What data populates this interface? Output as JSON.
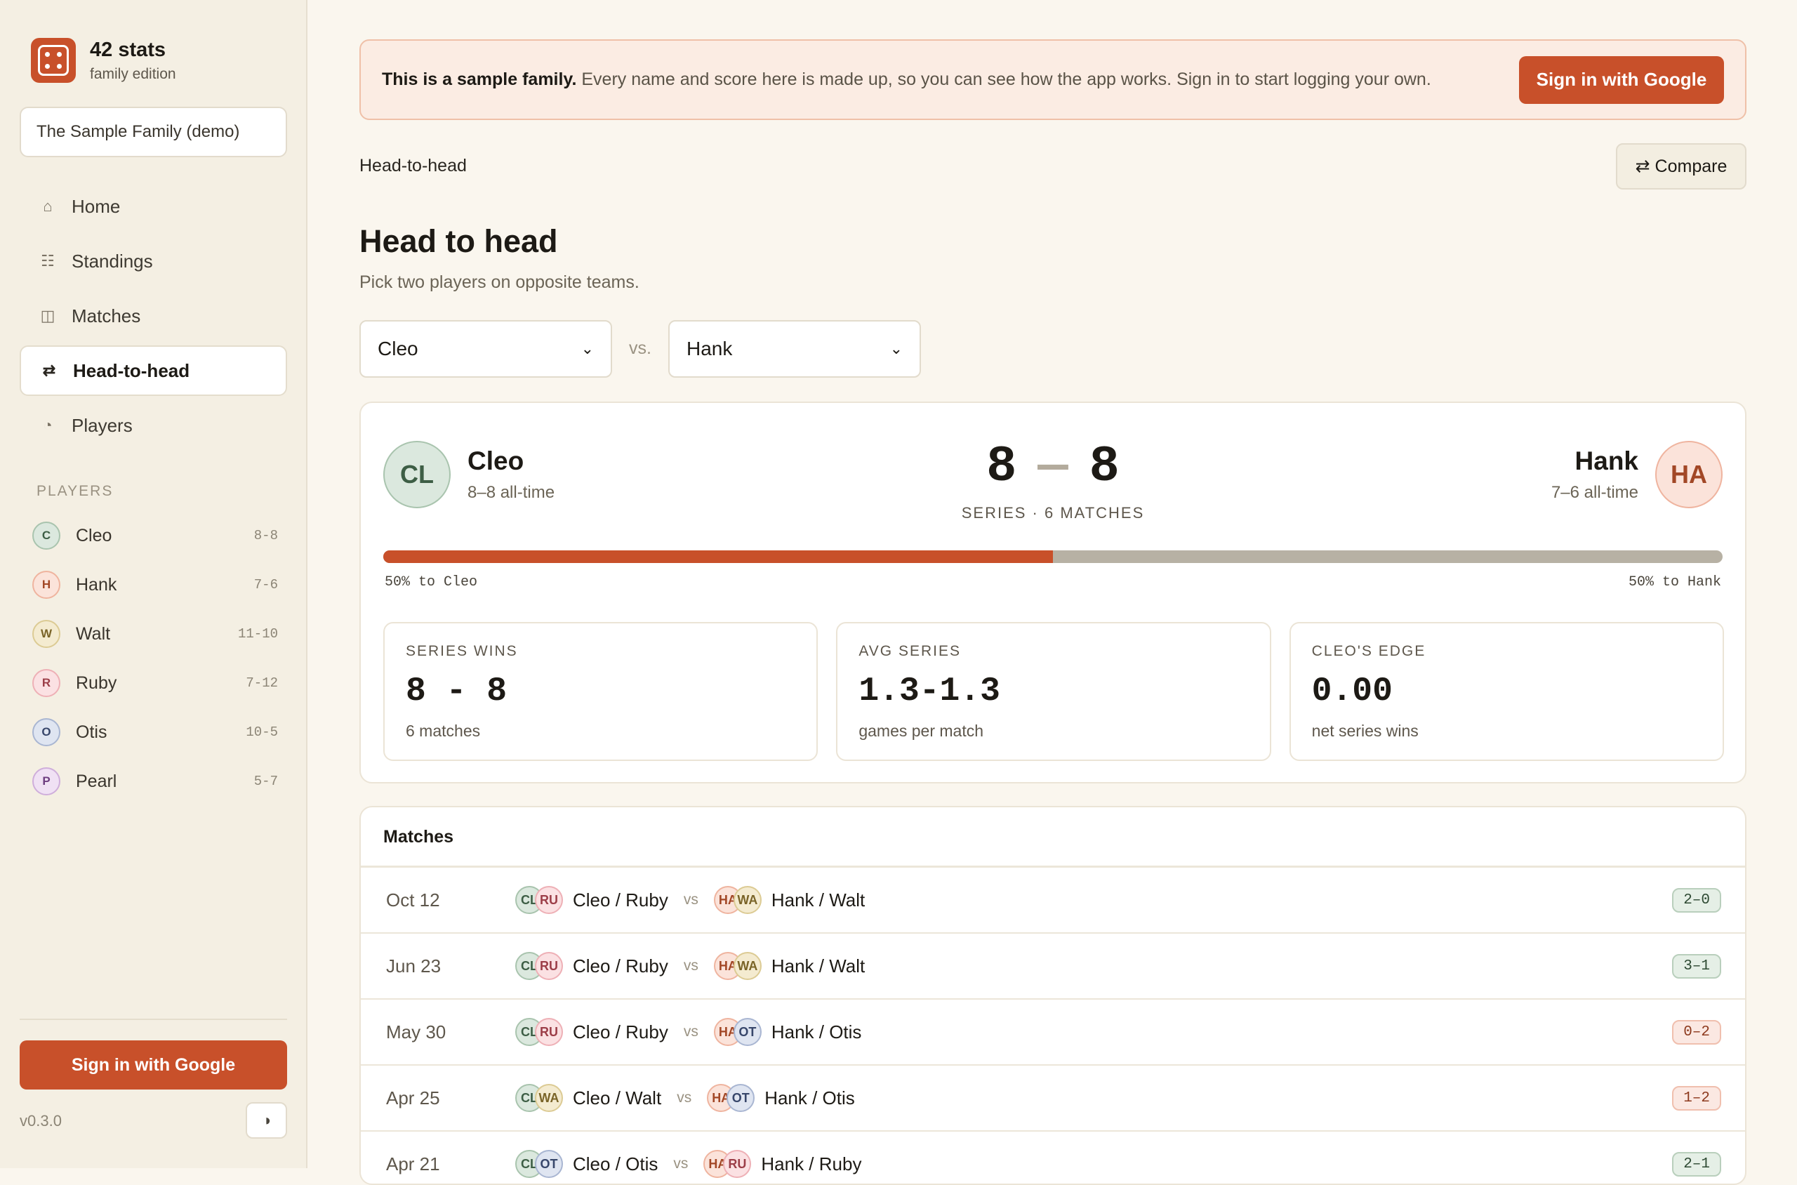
{
  "app": {
    "title": "42 stats",
    "subtitle": "family edition",
    "family": "The Sample Family (demo)",
    "version": "v0.3.0",
    "theme_icon": "◑"
  },
  "nav": [
    {
      "label": "Home",
      "icon": "⌂",
      "icon_name": "home-icon"
    },
    {
      "label": "Standings",
      "icon": "☷",
      "icon_name": "standings-icon"
    },
    {
      "label": "Matches",
      "icon": "◫",
      "icon_name": "matches-icon"
    },
    {
      "label": "Head-to-head",
      "icon": "⇄",
      "icon_name": "swap-icon"
    },
    {
      "label": "Players",
      "icon": "◔",
      "icon_name": "players-icon"
    }
  ],
  "sidebar": {
    "players_heading": "PLAYERS",
    "signin": "Sign in with Google"
  },
  "players": [
    {
      "initial": "C",
      "name": "Cleo",
      "record": "8-8"
    },
    {
      "initial": "H",
      "name": "Hank",
      "record": "7-6"
    },
    {
      "initial": "W",
      "name": "Walt",
      "record": "11-10"
    },
    {
      "initial": "R",
      "name": "Ruby",
      "record": "7-12"
    },
    {
      "initial": "O",
      "name": "Otis",
      "record": "10-5"
    },
    {
      "initial": "P",
      "name": "Pearl",
      "record": "5-7"
    }
  ],
  "banner": {
    "strong": "This is a sample family.",
    "text": " Every name and score here is made up, so you can see how the app works. Sign in to start logging your own.",
    "button": "Sign in with Google"
  },
  "page": {
    "breadcrumb": "Head-to-head",
    "compare": "⇄ Compare",
    "title": "Head to head",
    "subtitle": "Pick two players on opposite teams.",
    "player_a": "Cleo",
    "player_b": "Hank",
    "vs": "vs.",
    "chevron": "⌄"
  },
  "h2h": {
    "a": {
      "initials": "CL",
      "name": "Cleo",
      "record": "8–8 all-time"
    },
    "b": {
      "initials": "HA",
      "name": "Hank",
      "record": "7–6 all-time"
    },
    "score_a": "8",
    "score_b": "8",
    "dash": "—",
    "series_label": "SERIES · 6 MATCHES",
    "share_a": 0.5,
    "pct_a": "50% to Cleo",
    "pct_b": "50% to Hank"
  },
  "stats": [
    {
      "label": "SERIES WINS",
      "value": "8 - 8",
      "note": "6 matches"
    },
    {
      "label": "AVG SERIES",
      "value": "1.3-1.3",
      "note": "games per match"
    },
    {
      "label": "CLEO'S EDGE",
      "value": "0.00",
      "note": "net series wins"
    }
  ],
  "matches_heading": "Matches",
  "matches": [
    {
      "date": "Oct 12",
      "t1_av": [
        "CL",
        "RU"
      ],
      "t1": "Cleo / Ruby",
      "vs": "vs",
      "t2_av": [
        "HA",
        "WA"
      ],
      "t2": "Hank / Walt",
      "score": "2–0",
      "result": "win"
    },
    {
      "date": "Jun 23",
      "t1_av": [
        "CL",
        "RU"
      ],
      "t1": "Cleo / Ruby",
      "vs": "vs",
      "t2_av": [
        "HA",
        "WA"
      ],
      "t2": "Hank / Walt",
      "score": "3–1",
      "result": "win"
    },
    {
      "date": "May 30",
      "t1_av": [
        "CL",
        "RU"
      ],
      "t1": "Cleo / Ruby",
      "vs": "vs",
      "t2_av": [
        "HA",
        "OT"
      ],
      "t2": "Hank / Otis",
      "score": "0–2",
      "result": "loss"
    },
    {
      "date": "Apr 25",
      "t1_av": [
        "CL",
        "WA"
      ],
      "t1": "Cleo / Walt",
      "vs": "vs",
      "t2_av": [
        "HA",
        "OT"
      ],
      "t2": "Hank / Otis",
      "score": "1–2",
      "result": "loss"
    },
    {
      "date": "Apr 21",
      "t1_av": [
        "CL",
        "OT"
      ],
      "t1": "Cleo / Otis",
      "vs": "vs",
      "t2_av": [
        "HA",
        "RU"
      ],
      "t2": "Hank / Ruby",
      "score": "2–1",
      "result": "win"
    }
  ],
  "colors": {
    "accent": "#c8502a",
    "C": [
      "#dbe8de",
      "#a9c4ae",
      "#3d5e45"
    ],
    "H": [
      "#fbe3da",
      "#efb49f",
      "#a24726"
    ],
    "W": [
      "#f4ebd0",
      "#dccb94",
      "#7a6428"
    ],
    "R": [
      "#fbe1e3",
      "#eeb0b6",
      "#9c3e48"
    ],
    "O": [
      "#dfe5f1",
      "#a9b6d2",
      "#38476b"
    ],
    "P": [
      "#f0e1f4",
      "#cfaedb",
      "#6e3e80"
    ]
  }
}
